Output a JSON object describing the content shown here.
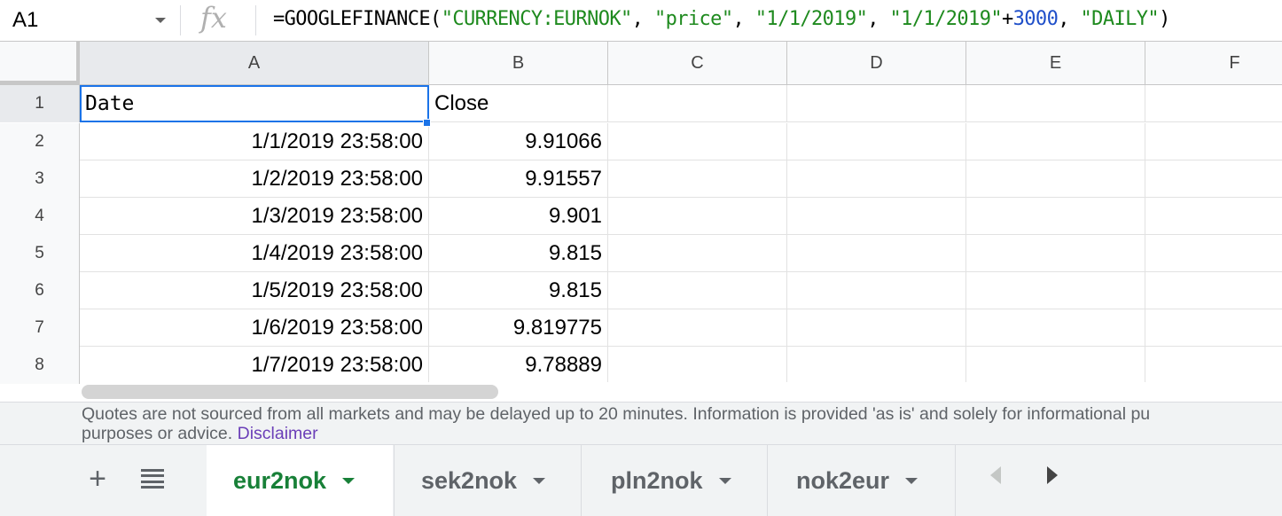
{
  "namebox": {
    "cell_ref": "A1"
  },
  "formula_bar": {
    "fx": "fx",
    "parts": [
      {
        "text": "=GOOGLEFINANCE(",
        "kind": "plain"
      },
      {
        "text": "\"CURRENCY:EURNOK\"",
        "kind": "str"
      },
      {
        "text": ", ",
        "kind": "plain"
      },
      {
        "text": "\"price\"",
        "kind": "str"
      },
      {
        "text": ", ",
        "kind": "plain"
      },
      {
        "text": "\"1/1/2019\"",
        "kind": "str"
      },
      {
        "text": ", ",
        "kind": "plain"
      },
      {
        "text": "\"1/1/2019\"",
        "kind": "str"
      },
      {
        "text": "+",
        "kind": "plain"
      },
      {
        "text": "3000",
        "kind": "num"
      },
      {
        "text": ", ",
        "kind": "plain"
      },
      {
        "text": "\"DAILY\"",
        "kind": "str"
      },
      {
        "text": ")",
        "kind": "plain"
      }
    ]
  },
  "columns": [
    "A",
    "B",
    "C",
    "D",
    "E",
    "F"
  ],
  "rows": [
    {
      "num": "1",
      "a": "Date",
      "b": "Close"
    },
    {
      "num": "2",
      "a": "1/1/2019 23:58:00",
      "b": "9.91066"
    },
    {
      "num": "3",
      "a": "1/2/2019 23:58:00",
      "b": "9.91557"
    },
    {
      "num": "4",
      "a": "1/3/2019 23:58:00",
      "b": "9.901"
    },
    {
      "num": "5",
      "a": "1/4/2019 23:58:00",
      "b": "9.815"
    },
    {
      "num": "6",
      "a": "1/5/2019 23:58:00",
      "b": "9.815"
    },
    {
      "num": "7",
      "a": "1/6/2019 23:58:00",
      "b": "9.819775"
    },
    {
      "num": "8",
      "a": "1/7/2019 23:58:00",
      "b": "9.78889"
    }
  ],
  "disclaimer": {
    "text": "Quotes are not sourced from all markets and may be delayed up to 20 minutes. Information is provided 'as is' and solely for informational purposes, not for trading purposes or advice.",
    "line1": "Quotes are not sourced from all markets and may be delayed up to 20 minutes. Information is provided 'as is' and solely for informational pu",
    "line2": "purposes or advice.",
    "link": "Disclaimer"
  },
  "tabs": {
    "add": "+",
    "sheets": [
      {
        "label": "eur2nok",
        "active": true
      },
      {
        "label": "sek2nok",
        "active": false
      },
      {
        "label": "pln2nok",
        "active": false
      },
      {
        "label": "nok2eur",
        "active": false
      }
    ]
  },
  "colors": {
    "selection": "#1a73e8",
    "active_tab_text": "#188038",
    "formula_string": "#1e8a1e",
    "formula_number": "#1f4fc9",
    "link": "#6b3fb8"
  }
}
